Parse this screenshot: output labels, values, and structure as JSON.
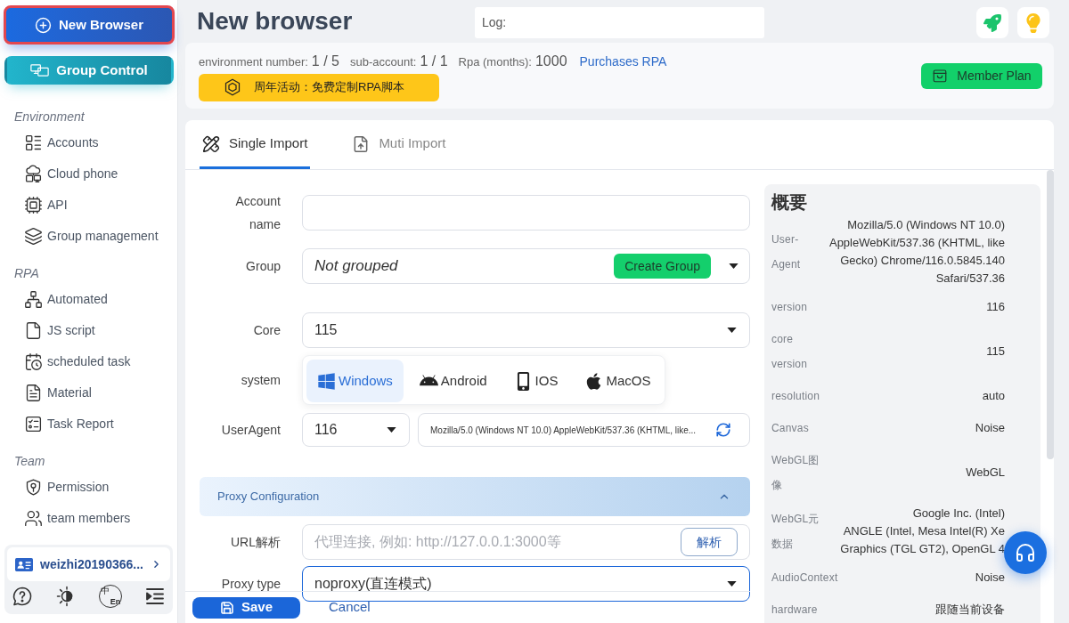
{
  "sidebar": {
    "buttons": [
      {
        "label": "New Browser",
        "highlighted": true
      },
      {
        "label": "Group Control",
        "highlighted": false
      }
    ],
    "sections": [
      {
        "title": "Environment",
        "items": [
          {
            "label": "Accounts"
          },
          {
            "label": "Cloud phone"
          },
          {
            "label": "API"
          },
          {
            "label": "Group management"
          }
        ]
      },
      {
        "title": "RPA",
        "items": [
          {
            "label": "Automated"
          },
          {
            "label": "JS script"
          },
          {
            "label": "scheduled task"
          },
          {
            "label": "Material"
          },
          {
            "label": "Task Report"
          }
        ]
      },
      {
        "title": "Team",
        "items": [
          {
            "label": "Permission"
          },
          {
            "label": "team members"
          }
        ]
      }
    ],
    "account": {
      "name": "weizhi20190366..."
    },
    "language": {
      "primary": "中",
      "secondary": "En"
    }
  },
  "header": {
    "title": "New browser",
    "log": {
      "label": "Log:"
    }
  },
  "info": {
    "stats": [
      {
        "label": "environment number:",
        "value": "1 / 5"
      },
      {
        "label": "sub-account:",
        "value": "1 / 1"
      },
      {
        "label": "Rpa (months):",
        "value": "1000"
      }
    ],
    "link": "Purchases RPA",
    "promo": "周年活动：免费定制RPA脚本",
    "member_plan": "Member Plan"
  },
  "tabs": [
    {
      "label": "Single Import",
      "selected": true
    },
    {
      "label": "Muti Import",
      "selected": false
    }
  ],
  "form": {
    "fields": [
      {
        "kind": "text",
        "label": "Account name",
        "focused": false
      },
      {
        "kind": "group",
        "label": "Group",
        "value": "Not grouped",
        "button": "Create Group",
        "focused": false
      },
      {
        "kind": "select",
        "label": "Core",
        "value": "115",
        "focused": false
      },
      {
        "kind": "segmented",
        "label": "system",
        "options": [
          {
            "label": "Windows",
            "selected": true
          },
          {
            "label": "Android",
            "selected": false
          },
          {
            "label": "IOS",
            "selected": false
          },
          {
            "label": "MacOS",
            "selected": false
          }
        ]
      },
      {
        "kind": "useragent",
        "label": "UserAgent",
        "version": "116",
        "value": "Mozilla/5.0 (Windows NT 10.0) AppleWebKit/537.36 (KHTML, like...",
        "focused": false
      }
    ],
    "proxy": {
      "title": "Proxy Configuration",
      "expanded": true,
      "fields": [
        {
          "kind": "url",
          "label": "URL解析",
          "placeholder": "代理连接, 例如: http://127.0.0.1:3000等",
          "button": "解析",
          "focused": false
        },
        {
          "kind": "select",
          "label": "Proxy type",
          "value": "noproxy(直连模式)",
          "focused": true
        }
      ]
    }
  },
  "actions": {
    "save": "Save",
    "cancel": "Cancel"
  },
  "overview": {
    "title": "概要",
    "rows": [
      {
        "label": "User-Agent",
        "values": [
          "Mozilla/5.0 (Windows NT 10.0) AppleWebKit/537.36 (KHTML, like Gecko) Chrome/116.0.5845.140 Safari/537.36"
        ]
      },
      {
        "label": "version",
        "values": [
          "116"
        ]
      },
      {
        "label": "core version",
        "values": [
          "115"
        ]
      },
      {
        "label": "resolution",
        "values": [
          "auto"
        ]
      },
      {
        "label": "Canvas",
        "values": [
          "Noise"
        ]
      },
      {
        "label": "WebGL图像",
        "values": [
          "WebGL"
        ]
      },
      {
        "label": "WebGL元数据",
        "values": [
          "Google Inc. (Intel)",
          "ANGLE (Intel, Mesa Intel(R) Xe Graphics (TGL GT2), OpenGL 4"
        ]
      },
      {
        "label": "AudioContext",
        "values": [
          "Noise"
        ]
      },
      {
        "label": "hardware",
        "values": [
          "跟随当前设备"
        ]
      }
    ]
  }
}
